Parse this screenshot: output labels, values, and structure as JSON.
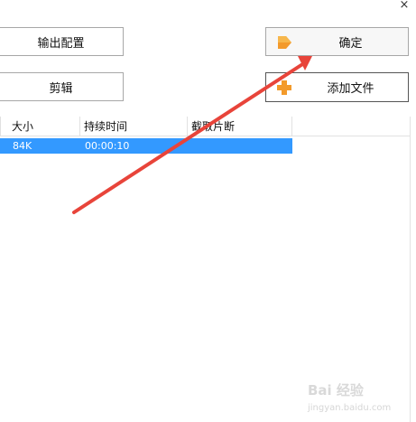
{
  "window": {
    "close_glyph": "×"
  },
  "buttons": {
    "output_config": "输出配置",
    "clip": "剪辑",
    "confirm": "确定",
    "add_file": "添加文件"
  },
  "icons": {
    "confirm": "orange-arrow-icon",
    "add_file": "orange-plus-icon"
  },
  "table": {
    "columns": [
      "大小",
      "持续时间",
      "截取片断"
    ],
    "rows": [
      {
        "size": "84K",
        "duration": "00:00:10",
        "cut": ""
      }
    ],
    "selected_row_color": "#3399ff"
  },
  "annotation": {
    "arrow_color": "#e8443a"
  },
  "watermark": {
    "brand": "Bai 经验",
    "url": "jingyan.baidu.com"
  }
}
